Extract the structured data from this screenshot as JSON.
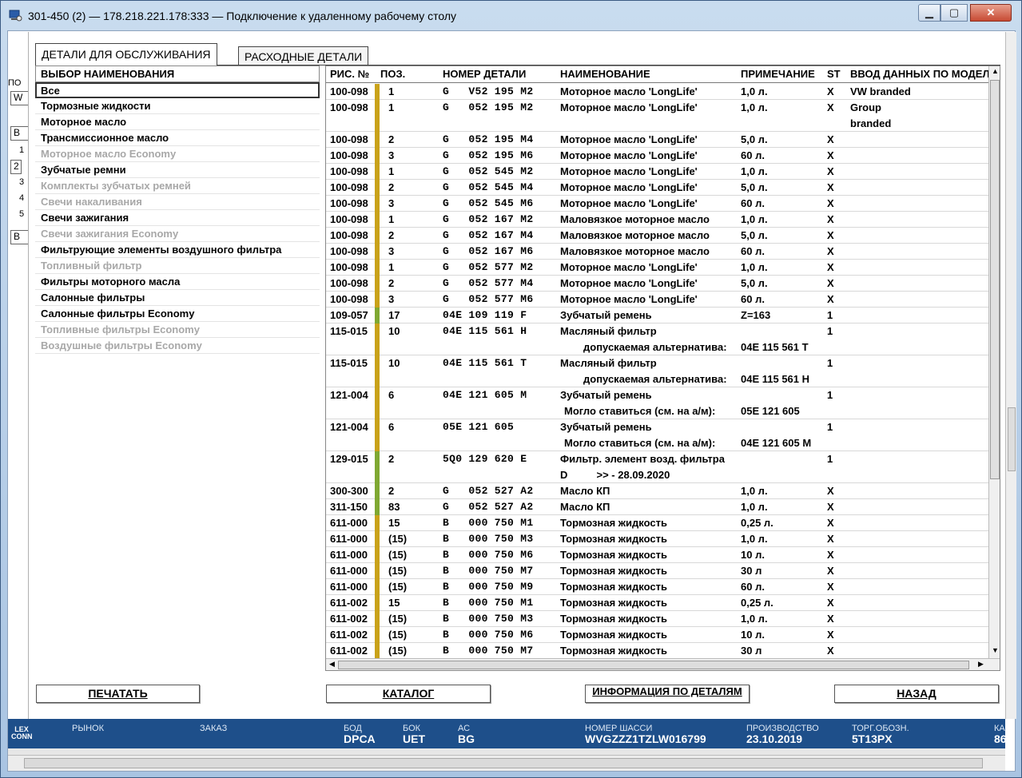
{
  "window": {
    "title": "301-450 (2) — 178.218.221.178:333 — Подключение к удаленному рабочему столу",
    "min_glyph": "▁",
    "max_glyph": "▢",
    "close_glyph": "✕"
  },
  "left_strip": {
    "label_top": "ПО",
    "box_top": "W",
    "box2": "B",
    "n1": "1",
    "n2": "2",
    "n3": "3",
    "n4": "4",
    "n5": "5",
    "box3": "B"
  },
  "tabs": {
    "service_parts": "ДЕТАЛИ ДЛЯ ОБСЛУЖИВАНИЯ",
    "consumables": "РАСХОДНЫЕ ДЕТАЛИ"
  },
  "categories": {
    "header": "ВЫБОР НАИМЕНОВАНИЯ",
    "items": [
      {
        "label": "Все",
        "state": "selected"
      },
      {
        "label": "Тормозные жидкости",
        "state": "enabled"
      },
      {
        "label": "Моторное масло",
        "state": "enabled"
      },
      {
        "label": "Трансмиссионное масло",
        "state": "enabled"
      },
      {
        "label": "Моторное масло Economy",
        "state": "disabled"
      },
      {
        "label": "Зубчатые ремни",
        "state": "enabled"
      },
      {
        "label": "Комплекты зубчатых ремней",
        "state": "disabled"
      },
      {
        "label": "Свечи накаливания",
        "state": "disabled"
      },
      {
        "label": "Свечи зажигания",
        "state": "enabled"
      },
      {
        "label": "Свечи зажигания Economy",
        "state": "disabled"
      },
      {
        "label": "Фильтрующие элементы воздушного фильтра",
        "state": "enabled"
      },
      {
        "label": "Топливный фильтр",
        "state": "disabled"
      },
      {
        "label": "Фильтры моторного масла",
        "state": "enabled"
      },
      {
        "label": "Салонные фильтры",
        "state": "enabled"
      },
      {
        "label": "Салонные фильтры Economy",
        "state": "enabled"
      },
      {
        "label": "Топливные фильтры Economy",
        "state": "disabled"
      },
      {
        "label": "Воздушные фильтры Economy",
        "state": "disabled"
      }
    ]
  },
  "grid": {
    "headers": {
      "fig": "РИС. №",
      "pos": "ПОЗ.",
      "part": "НОМЕР ДЕТАЛИ",
      "name": "НАИМЕНОВАНИЕ",
      "note": "ПРИМЕЧАНИЕ",
      "st": "ST",
      "vin": "ВВОД ДАННЫХ ПО МОДЕЛ"
    },
    "colors": {
      "gold": "#c9a21a",
      "green": "#7fa832"
    },
    "rows": [
      {
        "fig": "100-098",
        "pos": "1",
        "part": "G   V52 195 M2",
        "name": "Моторное масло 'LongLife'",
        "note": "1,0 л.",
        "st": "X",
        "vin": "VW branded",
        "bar": "gold"
      },
      {
        "fig": "100-098",
        "pos": "1",
        "part": "G   052 195 M2",
        "name": "Моторное масло 'LongLife'",
        "note": "1,0 л.",
        "st": "X",
        "vin": "Group",
        "vin2": "branded",
        "bar": "gold"
      },
      {
        "fig": "100-098",
        "pos": "2",
        "part": "G   052 195 M4",
        "name": "Моторное масло 'LongLife'",
        "note": "5,0 л.",
        "st": "X",
        "bar": "gold"
      },
      {
        "fig": "100-098",
        "pos": "3",
        "part": "G   052 195 M6",
        "name": "Моторное масло 'LongLife'",
        "note": "60 л.",
        "st": "X",
        "bar": "gold"
      },
      {
        "fig": "100-098",
        "pos": "1",
        "part": "G   052 545 M2",
        "name": "Моторное масло 'LongLife'",
        "note": "1,0 л.",
        "st": "X",
        "bar": "gold"
      },
      {
        "fig": "100-098",
        "pos": "2",
        "part": "G   052 545 M4",
        "name": "Моторное масло 'LongLife'",
        "note": "5,0 л.",
        "st": "X",
        "bar": "gold"
      },
      {
        "fig": "100-098",
        "pos": "3",
        "part": "G   052 545 M6",
        "name": "Моторное масло 'LongLife'",
        "note": "60 л.",
        "st": "X",
        "bar": "gold"
      },
      {
        "fig": "100-098",
        "pos": "1",
        "part": "G   052 167 M2",
        "name": "Маловязкое моторное масло",
        "note": "1,0 л.",
        "st": "X",
        "bar": "gold"
      },
      {
        "fig": "100-098",
        "pos": "2",
        "part": "G   052 167 M4",
        "name": "Маловязкое моторное масло",
        "note": "5,0 л.",
        "st": "X",
        "bar": "gold"
      },
      {
        "fig": "100-098",
        "pos": "3",
        "part": "G   052 167 M6",
        "name": "Маловязкое моторное масло",
        "note": "60 л.",
        "st": "X",
        "bar": "gold"
      },
      {
        "fig": "100-098",
        "pos": "1",
        "part": "G   052 577 M2",
        "name": "Моторное масло 'LongLife'",
        "note": "1,0 л.",
        "st": "X",
        "bar": "gold"
      },
      {
        "fig": "100-098",
        "pos": "2",
        "part": "G   052 577 M4",
        "name": "Моторное масло 'LongLife'",
        "note": "5,0 л.",
        "st": "X",
        "bar": "gold"
      },
      {
        "fig": "100-098",
        "pos": "3",
        "part": "G   052 577 M6",
        "name": "Моторное масло 'LongLife'",
        "note": "60 л.",
        "st": "X",
        "bar": "gold"
      },
      {
        "fig": "109-057",
        "pos": "17",
        "part": "04E 109 119 F",
        "name": "Зубчатый ремень",
        "note": "Z=163",
        "st": "1",
        "bar": "green"
      },
      {
        "fig": "115-015",
        "pos": "10",
        "part": "04E 115 561 H",
        "name": "Масляный фильтр",
        "name2": "допускаемая альтернатива:",
        "note2": "04E 115 561 T",
        "st": "1",
        "bar": "gold"
      },
      {
        "fig": "115-015",
        "pos": "10",
        "part": "04E 115 561 T",
        "name": "Масляный фильтр",
        "name2": "допускаемая альтернатива:",
        "note2": "04E 115 561 H",
        "st": "1",
        "bar": "gold"
      },
      {
        "fig": "121-004",
        "pos": "6",
        "part": "04E 121 605 M",
        "name": "Зубчатый ремень",
        "name2": "Могло ставиться (см. на а/м):",
        "note2": "05E 121 605",
        "st": "1",
        "bar": "gold"
      },
      {
        "fig": "121-004",
        "pos": "6",
        "part": "05E 121 605",
        "name": "Зубчатый ремень",
        "name2": "Могло ставиться (см. на а/м):",
        "note2": "04E 121 605 M",
        "st": "1",
        "bar": "gold"
      },
      {
        "fig": "129-015",
        "pos": "2",
        "part": "5Q0 129 620 E",
        "name": "Фильтр. элемент возд. фильтра",
        "name2": "D          >> - 28.09.2020",
        "st": "1",
        "bar": "green"
      },
      {
        "fig": "300-300",
        "pos": "2",
        "part": "G   052 527 A2",
        "name": "Масло КП",
        "note": "1,0 л.",
        "st": "X",
        "bar": "green"
      },
      {
        "fig": "311-150",
        "pos": "83",
        "part": "G   052 527 A2",
        "name": "Масло КП",
        "note": "1,0 л.",
        "st": "X",
        "bar": "green"
      },
      {
        "fig": "611-000",
        "pos": "15",
        "part": "B   000 750 M1",
        "name": "Тормозная жидкость",
        "note": "0,25 л.",
        "st": "X",
        "bar": "gold"
      },
      {
        "fig": "611-000",
        "pos": "(15)",
        "part": "B   000 750 M3",
        "name": "Тормозная жидкость",
        "note": "1,0 л.",
        "st": "X",
        "bar": "gold"
      },
      {
        "fig": "611-000",
        "pos": "(15)",
        "part": "B   000 750 M6",
        "name": "Тормозная жидкость",
        "note": "10 л.",
        "st": "X",
        "bar": "gold"
      },
      {
        "fig": "611-000",
        "pos": "(15)",
        "part": "B   000 750 M7",
        "name": "Тормозная жидкость",
        "note": "30 л",
        "st": "X",
        "bar": "gold"
      },
      {
        "fig": "611-000",
        "pos": "(15)",
        "part": "B   000 750 M9",
        "name": "Тормозная жидкость",
        "note": "60 л.",
        "st": "X",
        "bar": "gold"
      },
      {
        "fig": "611-002",
        "pos": "15",
        "part": "B   000 750 M1",
        "name": "Тормозная жидкость",
        "note": "0,25 л.",
        "st": "X",
        "bar": "gold"
      },
      {
        "fig": "611-002",
        "pos": "(15)",
        "part": "B   000 750 M3",
        "name": "Тормозная жидкость",
        "note": "1,0 л.",
        "st": "X",
        "bar": "gold"
      },
      {
        "fig": "611-002",
        "pos": "(15)",
        "part": "B   000 750 M6",
        "name": "Тормозная жидкость",
        "note": "10 л.",
        "st": "X",
        "bar": "gold"
      },
      {
        "fig": "611-002",
        "pos": "(15)",
        "part": "B   000 750 M7",
        "name": "Тормозная жидкость",
        "note": "30 л",
        "st": "X",
        "bar": "gold"
      }
    ]
  },
  "buttons": {
    "print": "ПЕЧАТАТЬ",
    "catalog": "КАТАЛОГ",
    "info": "ИНФОРМАЦИЯ ПО ДЕТАЛЯМ",
    "back": "НАЗАД"
  },
  "status": {
    "logo_top": "LEX",
    "logo_bottom": "CONN",
    "market_label": "РЫНОК",
    "order_label": "ЗАКАЗ",
    "bod_label": "БОД",
    "bod_value": "DPCA",
    "bok_label": "БОК",
    "bok_value": "UET",
    "ac_label": "АС",
    "ac_value": "BG",
    "vin_label": "НОМЕР ШАССИ",
    "vin_value": "WVGZZZ1TZLW016799",
    "prod_label": "ПРОИЗВОДСТВО",
    "prod_value": "23.10.2019",
    "trade_label": "ТОРГ.ОБОЗН.",
    "trade_value": "5T13PX",
    "extra_label": "КА",
    "extra_value": "86"
  }
}
